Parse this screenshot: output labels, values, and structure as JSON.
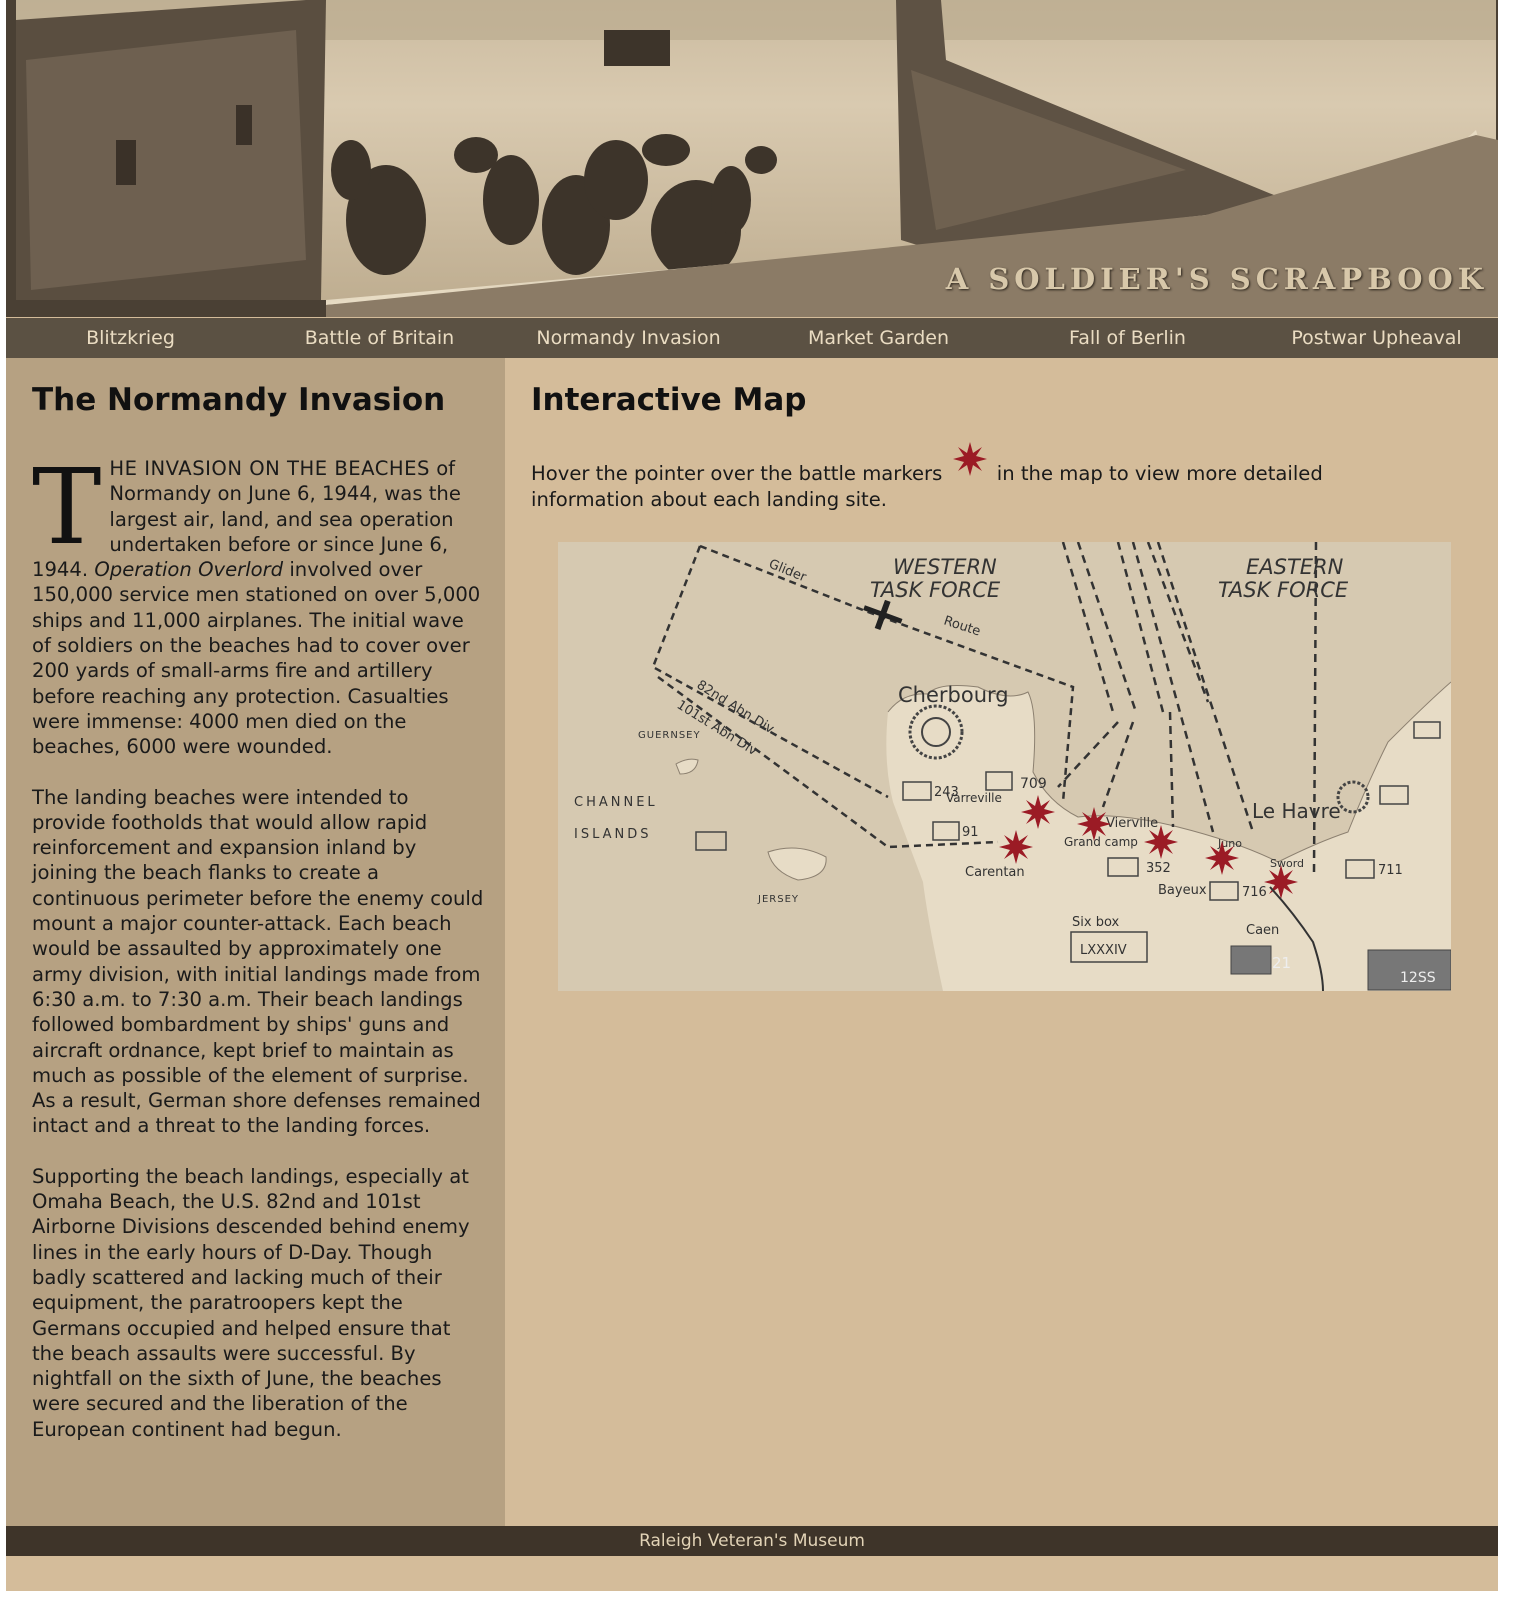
{
  "site": {
    "title": "A SOLDIER'S SCRAPBOOK"
  },
  "nav": [
    {
      "label": "Blitzkrieg"
    },
    {
      "label": "Battle of Britain"
    },
    {
      "label": "Normandy Invasion"
    },
    {
      "label": "Market Garden"
    },
    {
      "label": "Fall of Berlin"
    },
    {
      "label": "Postwar Upheaval"
    }
  ],
  "article": {
    "heading": "The Normandy Invasion",
    "dropcap": "T",
    "lead_caps": "HE INVASION ON THE BEACHES",
    "p1_a": " of Normandy on June 6, 1944, was the largest air, land, and sea operation undertaken before or since June 6, 1944. ",
    "p1_em": "Operation Overlord",
    "p1_b": " involved over 150,000 service men stationed on over 5,000 ships and 11,000 airplanes. The initial wave of soldiers on the beaches had to cover over 200 yards of small-arms fire and artillery before reaching any protection. Casualties were immense: 4000 men died on the beaches, 6000 were wounded.",
    "p2": "The landing beaches were intended to provide footholds that would allow rapid reinforcement and expansion inland by joining the beach flanks to create a continuous perimeter before the enemy could mount a major counter-attack. Each beach would be assaulted by approximately one army division, with initial landings made from 6:30 a.m. to 7:30 a.m. Their beach landings followed bombardment by ships' guns and aircraft ordnance, kept brief to maintain as much as possible of the element of surprise. As a result, German shore defenses remained intact and a threat to the landing forces.",
    "p3": "Supporting the beach landings, especially at Omaha Beach, the U.S. 82nd and 101st Airborne Divisions descended behind enemy lines in the early hours of D-Day. Though badly scattered and lacking much of their equipment, the paratroopers kept the Germans occupied and helped ensure that the beach assaults were successful. By nightfall on the sixth of June, the beaches were secured and the liberation of the European continent had begun."
  },
  "map_section": {
    "heading": "Interactive Map",
    "instr_before": "Hover the pointer over the battle markers",
    "instr_after": "in the map to view more detailed information about each landing site."
  },
  "map": {
    "labels": {
      "western": "WESTERN",
      "western2": "TASK FORCE",
      "eastern": "EASTERN",
      "eastern2": "TASK FORCE",
      "cherbourg": "Cherbourg",
      "le_havre": "Le Havre",
      "channel": "CHANNEL",
      "islands": "ISLANDS",
      "guernsey": "GUERNSEY",
      "jersey": "JERSEY",
      "carentan": "Carentan",
      "bayeux": "Bayeux",
      "caen": "Caen",
      "glider": "Glider",
      "route": "Route",
      "div82": "82nd Abn Div",
      "div101": "101st Abn Div",
      "u709": "709",
      "u243": "243",
      "u91": "91",
      "u352": "352",
      "u716": "716",
      "u711": "711",
      "u21": "21",
      "u12ss": "12SS",
      "lxxxiv": "LXXXIV",
      "sixbox": "Six box",
      "vierville": "Vierville",
      "grandcamp": "Grand camp",
      "sword": "Sword",
      "juno": "Juno",
      "verreville": "Varreville"
    },
    "marker_color": "#9b1b25"
  },
  "footer": {
    "text": "Raleigh Veteran's Museum"
  }
}
